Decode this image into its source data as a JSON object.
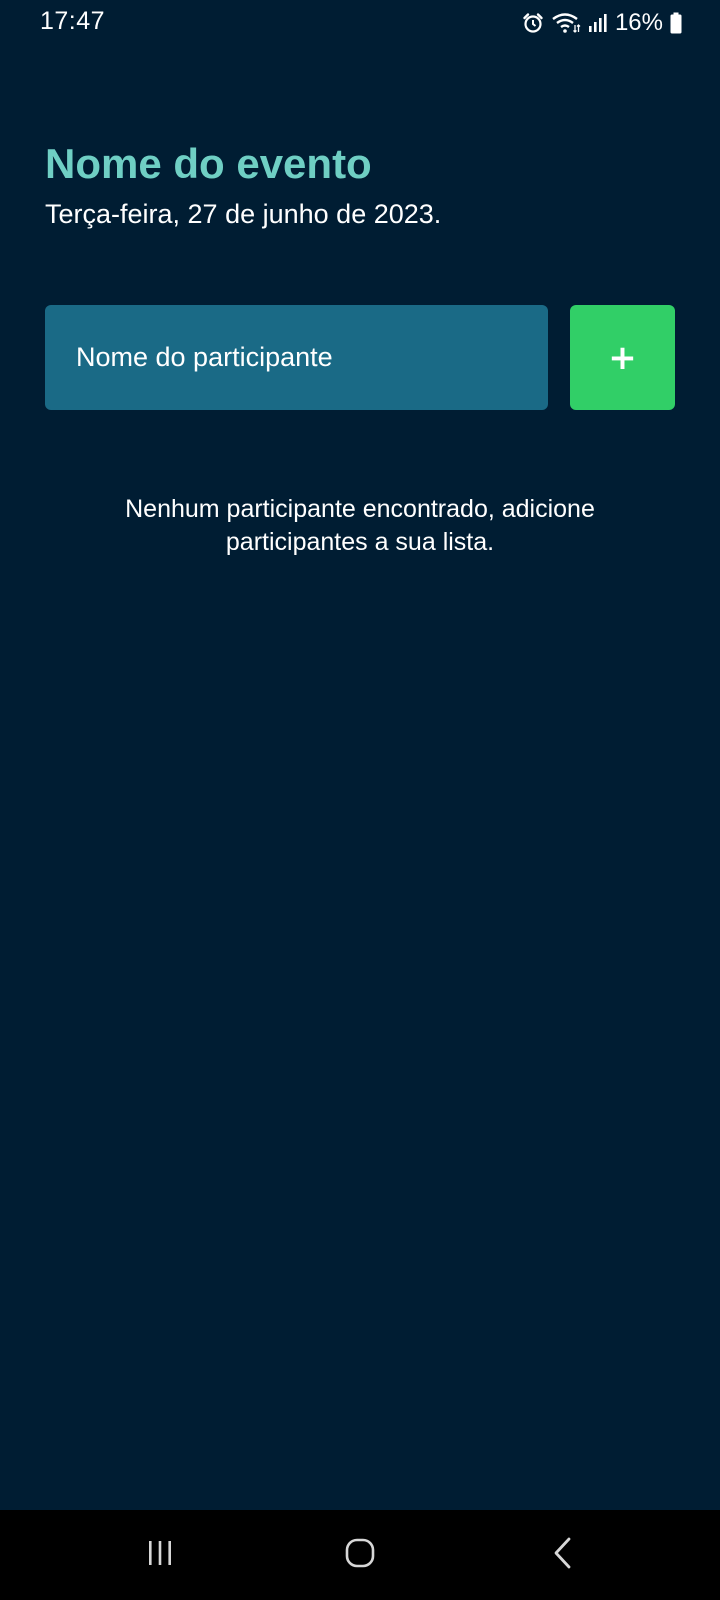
{
  "status_bar": {
    "time": "17:47",
    "battery": "16%",
    "icons": [
      "alarm-icon",
      "wifi-icon",
      "signal-icon",
      "battery-icon"
    ]
  },
  "event": {
    "title": "Nome do evento",
    "date": "Terça-feira, 27 de junho de 2023."
  },
  "form": {
    "participant_placeholder": "Nome do participante",
    "add_button_label": "+"
  },
  "empty_state": {
    "message": "Nenhum participante encontrado, adicione participantes a sua lista."
  },
  "nav_bar": {
    "icons": [
      "recents-icon",
      "home-icon",
      "back-icon"
    ]
  },
  "colors": {
    "background": "#001d33",
    "title": "#6fcfc4",
    "input_background": "#1a6a86",
    "add_button": "#31cf67"
  }
}
